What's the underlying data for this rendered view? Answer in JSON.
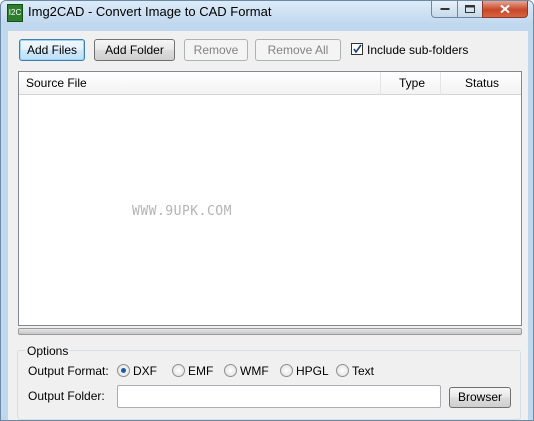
{
  "window": {
    "title": "Img2CAD - Convert Image to CAD Format",
    "app_icon_text": "I2C"
  },
  "toolbar": {
    "add_files": "Add Files",
    "add_folder": "Add Folder",
    "remove": "Remove",
    "remove_all": "Remove All",
    "include_subfolders": "Include sub-folders",
    "include_subfolders_checked": true
  },
  "file_list": {
    "columns": [
      "Source File",
      "Type",
      "Status"
    ],
    "rows": [],
    "watermark": "WWW.9UPK.COM"
  },
  "options": {
    "title": "Options",
    "output_format_label": "Output Format:",
    "formats": [
      "DXF",
      "EMF",
      "WMF",
      "HPGL",
      "Text"
    ],
    "selected_format": "DXF",
    "output_folder_label": "Output Folder:",
    "output_folder_value": "",
    "browser_label": "Browser"
  },
  "colors": {
    "accent": "#3c7fb1",
    "radio_dot": "#1b5aa7",
    "close_button": "#c8472a"
  }
}
